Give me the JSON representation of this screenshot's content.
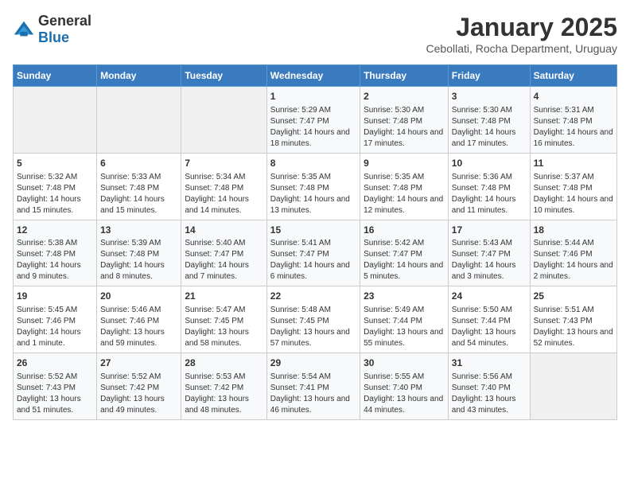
{
  "logo": {
    "general": "General",
    "blue": "Blue"
  },
  "header": {
    "month": "January 2025",
    "location": "Cebollati, Rocha Department, Uruguay"
  },
  "days_of_week": [
    "Sunday",
    "Monday",
    "Tuesday",
    "Wednesday",
    "Thursday",
    "Friday",
    "Saturday"
  ],
  "weeks": [
    [
      {
        "day": "",
        "info": ""
      },
      {
        "day": "",
        "info": ""
      },
      {
        "day": "",
        "info": ""
      },
      {
        "day": "1",
        "info": "Sunrise: 5:29 AM\nSunset: 7:47 PM\nDaylight: 14 hours and 18 minutes."
      },
      {
        "day": "2",
        "info": "Sunrise: 5:30 AM\nSunset: 7:48 PM\nDaylight: 14 hours and 17 minutes."
      },
      {
        "day": "3",
        "info": "Sunrise: 5:30 AM\nSunset: 7:48 PM\nDaylight: 14 hours and 17 minutes."
      },
      {
        "day": "4",
        "info": "Sunrise: 5:31 AM\nSunset: 7:48 PM\nDaylight: 14 hours and 16 minutes."
      }
    ],
    [
      {
        "day": "5",
        "info": "Sunrise: 5:32 AM\nSunset: 7:48 PM\nDaylight: 14 hours and 15 minutes."
      },
      {
        "day": "6",
        "info": "Sunrise: 5:33 AM\nSunset: 7:48 PM\nDaylight: 14 hours and 15 minutes."
      },
      {
        "day": "7",
        "info": "Sunrise: 5:34 AM\nSunset: 7:48 PM\nDaylight: 14 hours and 14 minutes."
      },
      {
        "day": "8",
        "info": "Sunrise: 5:35 AM\nSunset: 7:48 PM\nDaylight: 14 hours and 13 minutes."
      },
      {
        "day": "9",
        "info": "Sunrise: 5:35 AM\nSunset: 7:48 PM\nDaylight: 14 hours and 12 minutes."
      },
      {
        "day": "10",
        "info": "Sunrise: 5:36 AM\nSunset: 7:48 PM\nDaylight: 14 hours and 11 minutes."
      },
      {
        "day": "11",
        "info": "Sunrise: 5:37 AM\nSunset: 7:48 PM\nDaylight: 14 hours and 10 minutes."
      }
    ],
    [
      {
        "day": "12",
        "info": "Sunrise: 5:38 AM\nSunset: 7:48 PM\nDaylight: 14 hours and 9 minutes."
      },
      {
        "day": "13",
        "info": "Sunrise: 5:39 AM\nSunset: 7:48 PM\nDaylight: 14 hours and 8 minutes."
      },
      {
        "day": "14",
        "info": "Sunrise: 5:40 AM\nSunset: 7:47 PM\nDaylight: 14 hours and 7 minutes."
      },
      {
        "day": "15",
        "info": "Sunrise: 5:41 AM\nSunset: 7:47 PM\nDaylight: 14 hours and 6 minutes."
      },
      {
        "day": "16",
        "info": "Sunrise: 5:42 AM\nSunset: 7:47 PM\nDaylight: 14 hours and 5 minutes."
      },
      {
        "day": "17",
        "info": "Sunrise: 5:43 AM\nSunset: 7:47 PM\nDaylight: 14 hours and 3 minutes."
      },
      {
        "day": "18",
        "info": "Sunrise: 5:44 AM\nSunset: 7:46 PM\nDaylight: 14 hours and 2 minutes."
      }
    ],
    [
      {
        "day": "19",
        "info": "Sunrise: 5:45 AM\nSunset: 7:46 PM\nDaylight: 14 hours and 1 minute."
      },
      {
        "day": "20",
        "info": "Sunrise: 5:46 AM\nSunset: 7:46 PM\nDaylight: 13 hours and 59 minutes."
      },
      {
        "day": "21",
        "info": "Sunrise: 5:47 AM\nSunset: 7:45 PM\nDaylight: 13 hours and 58 minutes."
      },
      {
        "day": "22",
        "info": "Sunrise: 5:48 AM\nSunset: 7:45 PM\nDaylight: 13 hours and 57 minutes."
      },
      {
        "day": "23",
        "info": "Sunrise: 5:49 AM\nSunset: 7:44 PM\nDaylight: 13 hours and 55 minutes."
      },
      {
        "day": "24",
        "info": "Sunrise: 5:50 AM\nSunset: 7:44 PM\nDaylight: 13 hours and 54 minutes."
      },
      {
        "day": "25",
        "info": "Sunrise: 5:51 AM\nSunset: 7:43 PM\nDaylight: 13 hours and 52 minutes."
      }
    ],
    [
      {
        "day": "26",
        "info": "Sunrise: 5:52 AM\nSunset: 7:43 PM\nDaylight: 13 hours and 51 minutes."
      },
      {
        "day": "27",
        "info": "Sunrise: 5:52 AM\nSunset: 7:42 PM\nDaylight: 13 hours and 49 minutes."
      },
      {
        "day": "28",
        "info": "Sunrise: 5:53 AM\nSunset: 7:42 PM\nDaylight: 13 hours and 48 minutes."
      },
      {
        "day": "29",
        "info": "Sunrise: 5:54 AM\nSunset: 7:41 PM\nDaylight: 13 hours and 46 minutes."
      },
      {
        "day": "30",
        "info": "Sunrise: 5:55 AM\nSunset: 7:40 PM\nDaylight: 13 hours and 44 minutes."
      },
      {
        "day": "31",
        "info": "Sunrise: 5:56 AM\nSunset: 7:40 PM\nDaylight: 13 hours and 43 minutes."
      },
      {
        "day": "",
        "info": ""
      }
    ]
  ]
}
